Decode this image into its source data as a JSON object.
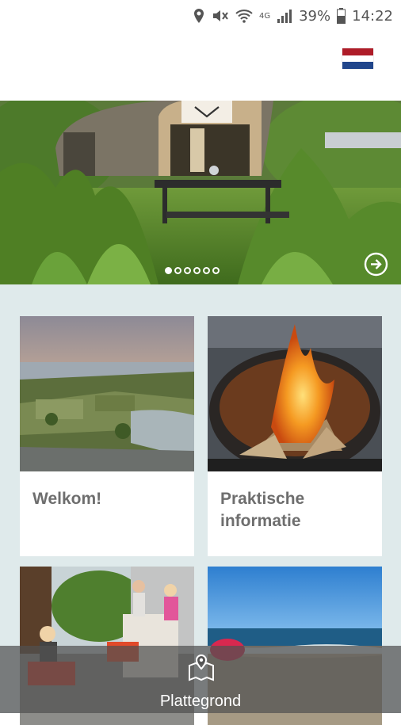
{
  "status_bar": {
    "network": "4G",
    "battery": "39%",
    "time": "14:22"
  },
  "header": {
    "language_flag": "netherlands-flag",
    "flag_colors": [
      "#ae1c28",
      "#ffffff",
      "#21468b"
    ]
  },
  "hero": {
    "slide_count": 6,
    "active_slide": 1,
    "toggle_icon": "chevron-down-icon",
    "next_icon": "arrow-right-circle-icon"
  },
  "tiles": [
    {
      "title": "Welkom!",
      "image": "lake-aerial-photo"
    },
    {
      "title": "Praktische\ninformatie",
      "title_line1": "Praktische",
      "title_line2": "informatie",
      "image": "fire-pit-photo"
    },
    {
      "title": "",
      "image": "children-playground-photo"
    },
    {
      "title": "",
      "image": "beach-photo"
    }
  ],
  "bottom_bar": {
    "label": "Plattegrond",
    "icon": "map-pin-icon"
  },
  "colors": {
    "content_bg": "#dfeaeb",
    "tile_title": "#6e6e6e",
    "bottom_bar": "rgba(80,80,80,0.72)"
  }
}
